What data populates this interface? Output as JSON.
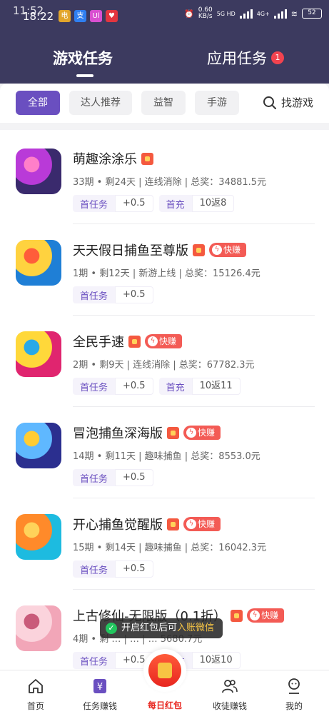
{
  "status_bar": {
    "time_ghost": "11:52",
    "time": "18:22",
    "apps": [
      "电",
      "支",
      "Ul",
      "♥"
    ],
    "network_speed": "0.60",
    "network_unit": "KB/s",
    "signal_1": "5G HD",
    "signal_2": "4G+",
    "battery": "52"
  },
  "top_tabs": {
    "games": "游戏任务",
    "apps": "应用任务",
    "apps_badge": "1"
  },
  "filters": {
    "chips": [
      "全部",
      "达人推荐",
      "益智",
      "手游"
    ],
    "active_index": 0,
    "search_label": "找游戏"
  },
  "tasks": [
    {
      "title": "萌趣涂涂乐",
      "hot": true,
      "fast": false,
      "meta": "33期 • 剩24天 | 连线消除 | 总奖：34881.5元",
      "pills": [
        {
          "k": "首任务",
          "v": "+0.5"
        },
        {
          "k": "首充",
          "v": "10返8"
        }
      ],
      "thumb_colors": [
        "#3a2a6d",
        "#b93ad8",
        "#ff7fc9"
      ]
    },
    {
      "title": "天天假日捕鱼至尊版",
      "hot": true,
      "fast": true,
      "meta": "1期 • 剩12天 | 新游上线 | 总奖：15126.4元",
      "pills": [
        {
          "k": "首任务",
          "v": "+0.5"
        }
      ],
      "thumb_colors": [
        "#1f7fd6",
        "#ffd23f",
        "#ff5d3a"
      ]
    },
    {
      "title": "全民手速",
      "hot": true,
      "fast": true,
      "meta": "2期 • 剩9天 | 连线消除 | 总奖：67782.3元",
      "pills": [
        {
          "k": "首任务",
          "v": "+0.5"
        },
        {
          "k": "首充",
          "v": "10返11"
        }
      ],
      "thumb_colors": [
        "#e0256f",
        "#ffd83a",
        "#29a9e8"
      ]
    },
    {
      "title": "冒泡捕鱼深海版",
      "hot": true,
      "fast": true,
      "meta": "14期 • 剩11天 | 趣味捕鱼 | 总奖：8553.0元",
      "pills": [
        {
          "k": "首任务",
          "v": "+0.5"
        }
      ],
      "thumb_colors": [
        "#2b2f8f",
        "#5fb8ff",
        "#ffcc33"
      ]
    },
    {
      "title": "开心捕鱼觉醒版",
      "hot": true,
      "fast": true,
      "meta": "15期 • 剩14天 | 趣味捕鱼 | 总奖：16042.3元",
      "pills": [
        {
          "k": "首任务",
          "v": "+0.5"
        }
      ],
      "thumb_colors": [
        "#1dbbe0",
        "#ff8a2a",
        "#ffd35a"
      ]
    },
    {
      "title": "上古修仙-无限版（0.1折）",
      "hot": true,
      "fast": true,
      "meta": "4期 • 剩 … | … | … 5680.7元",
      "pills": [
        {
          "k": "首任务",
          "v": "+0.5"
        },
        {
          "k": "首充",
          "v": "10返10"
        }
      ],
      "thumb_colors": [
        "#f2a6b8",
        "#fbd3dc",
        "#c95b7a"
      ]
    }
  ],
  "fast_tag_label": "快赚",
  "toast": {
    "prefix": "开启红包后可",
    "highlight": "入账微信"
  },
  "bottom_nav": {
    "home": "首页",
    "tasks": "任务赚钱",
    "daily": "每日红包",
    "recruit": "收徒赚钱",
    "me": "我的"
  }
}
